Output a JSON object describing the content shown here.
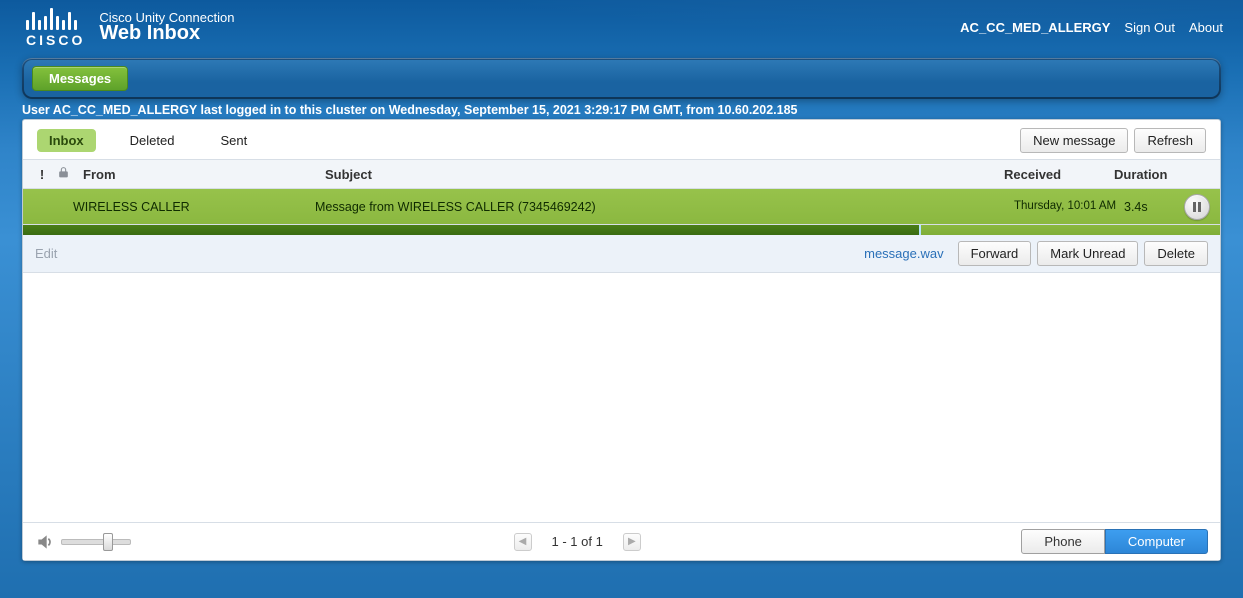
{
  "header": {
    "product_line1": "Cisco Unity Connection",
    "product_line2": "Web Inbox",
    "logo_word": "CISCO",
    "user_label": "AC_CC_MED_ALLERGY",
    "sign_out": "Sign Out",
    "about": "About"
  },
  "nav": {
    "messages_tab": "Messages"
  },
  "login_status": "User AC_CC_MED_ALLERGY last logged in to this cluster on Wednesday, September 15, 2021 3:29:17 PM GMT, from 10.60.202.185",
  "tabs": {
    "inbox": "Inbox",
    "deleted": "Deleted",
    "sent": "Sent",
    "active": "inbox"
  },
  "actions": {
    "new_message": "New message",
    "refresh": "Refresh"
  },
  "columns": {
    "priority": "!",
    "from": "From",
    "subject": "Subject",
    "received": "Received",
    "duration": "Duration"
  },
  "messages": [
    {
      "from": "WIRELESS CALLER",
      "subject": "Message from WIRELESS CALLER (7345469242)",
      "received": "Thursday, 10:01 AM",
      "duration": "3.4s",
      "playback_state": "paused",
      "playback_progress_pct": 76
    }
  ],
  "message_actions": {
    "edit": "Edit",
    "attachment": "message.wav",
    "forward": "Forward",
    "mark_unread": "Mark Unread",
    "delete": "Delete"
  },
  "footer": {
    "pager_text": "1 - 1 of 1",
    "volume_value": 70,
    "device_phone": "Phone",
    "device_computer": "Computer",
    "device_active": "computer"
  }
}
